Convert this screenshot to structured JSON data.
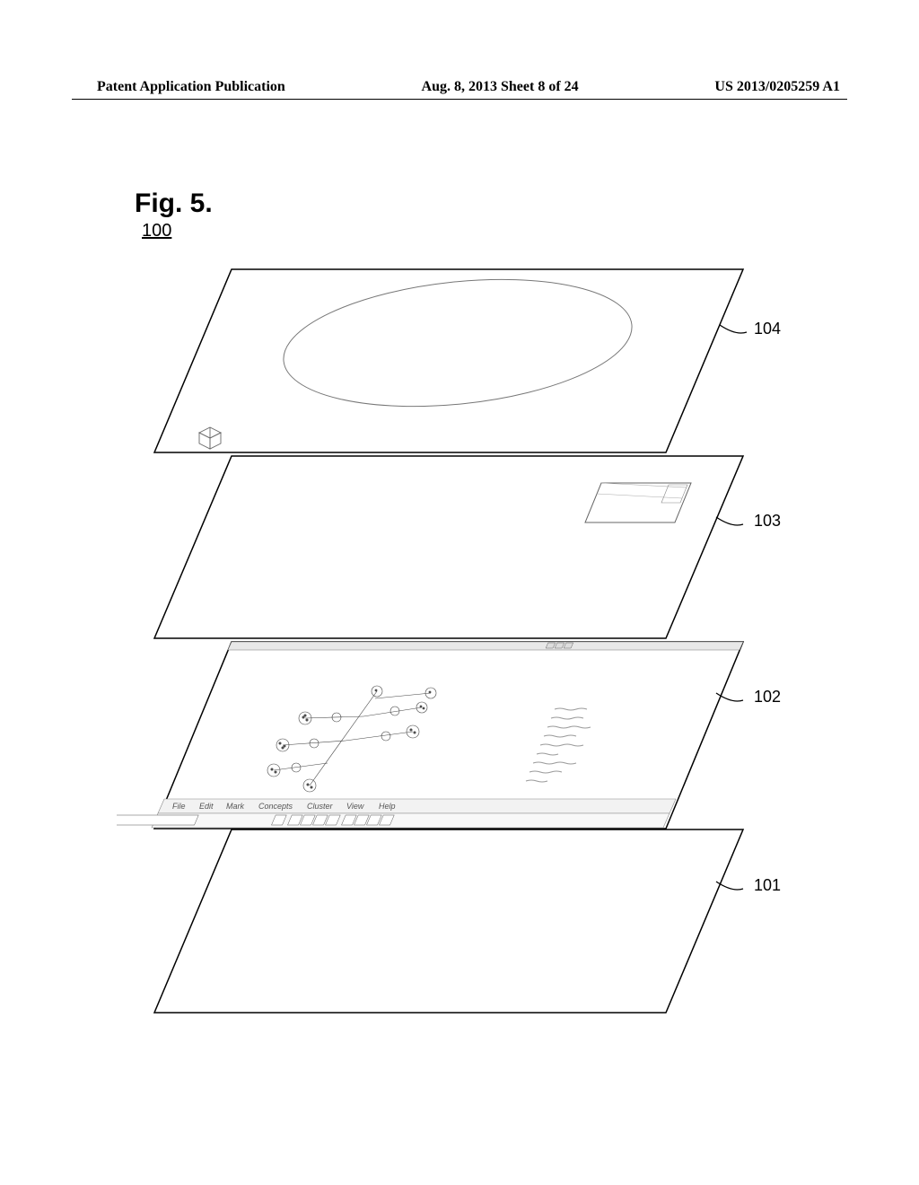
{
  "header": {
    "left": "Patent Application Publication",
    "center": "Aug. 8, 2013  Sheet 8 of 24",
    "right": "US 2013/0205259 A1"
  },
  "figure": {
    "label": "Fig. 5.",
    "number": "100"
  },
  "refs": {
    "r104": "104",
    "r103": "103",
    "r102": "102",
    "r101": "101"
  },
  "menubar": {
    "items": [
      "File",
      "Edit",
      "Mark",
      "Concepts",
      "Cluster",
      "View",
      "Help"
    ]
  }
}
